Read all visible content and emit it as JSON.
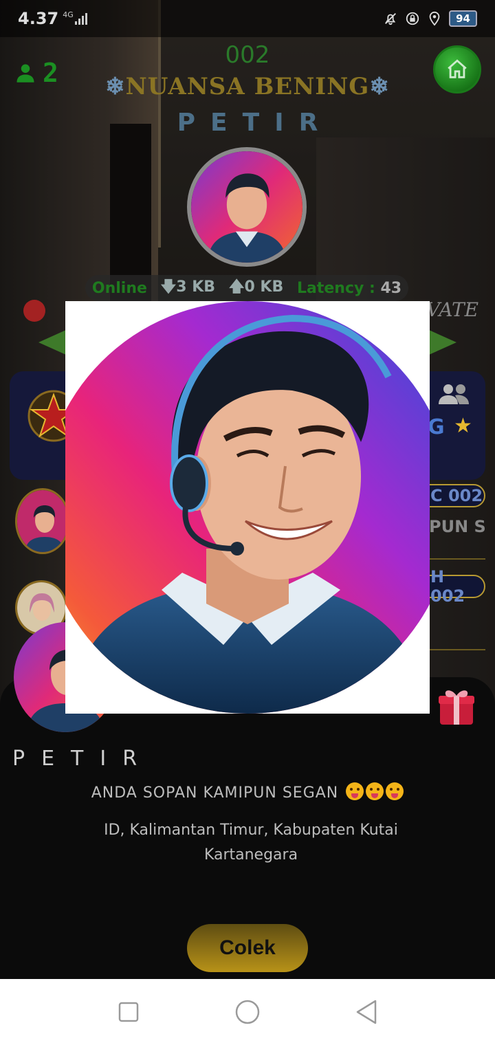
{
  "status_bar": {
    "time": "4.37",
    "network": "4G",
    "battery": "94",
    "icons": [
      "bell-muted-icon",
      "lock-rotation-icon",
      "location-icon"
    ]
  },
  "room": {
    "user_count": "2",
    "room_number": "002",
    "room_name": "NUANSA BENING",
    "room_name_decoration": "❄",
    "host_name": "PETIR",
    "private_label": "VATE"
  },
  "stats": {
    "online_label": "Online",
    "download": "3 KB",
    "upload": "0 KB",
    "latency_label": "Latency :",
    "latency_value": "43"
  },
  "side_fragments": {
    "right_row_1": "C 002",
    "right_row_2": "PUN S",
    "right_row_3": "H 002",
    "right_panel_letter": "G"
  },
  "profile": {
    "name": "PETIR",
    "bio": "ANDA SOPAN KAMIPUN SEGAN",
    "location": "ID, Kalimantan Timur, Kabupaten Kutai Kartanegara",
    "action_button": "Colek"
  },
  "colors": {
    "accent_green": "#1b8f22",
    "gold": "#b89218",
    "navy_panel": "#15183a"
  }
}
